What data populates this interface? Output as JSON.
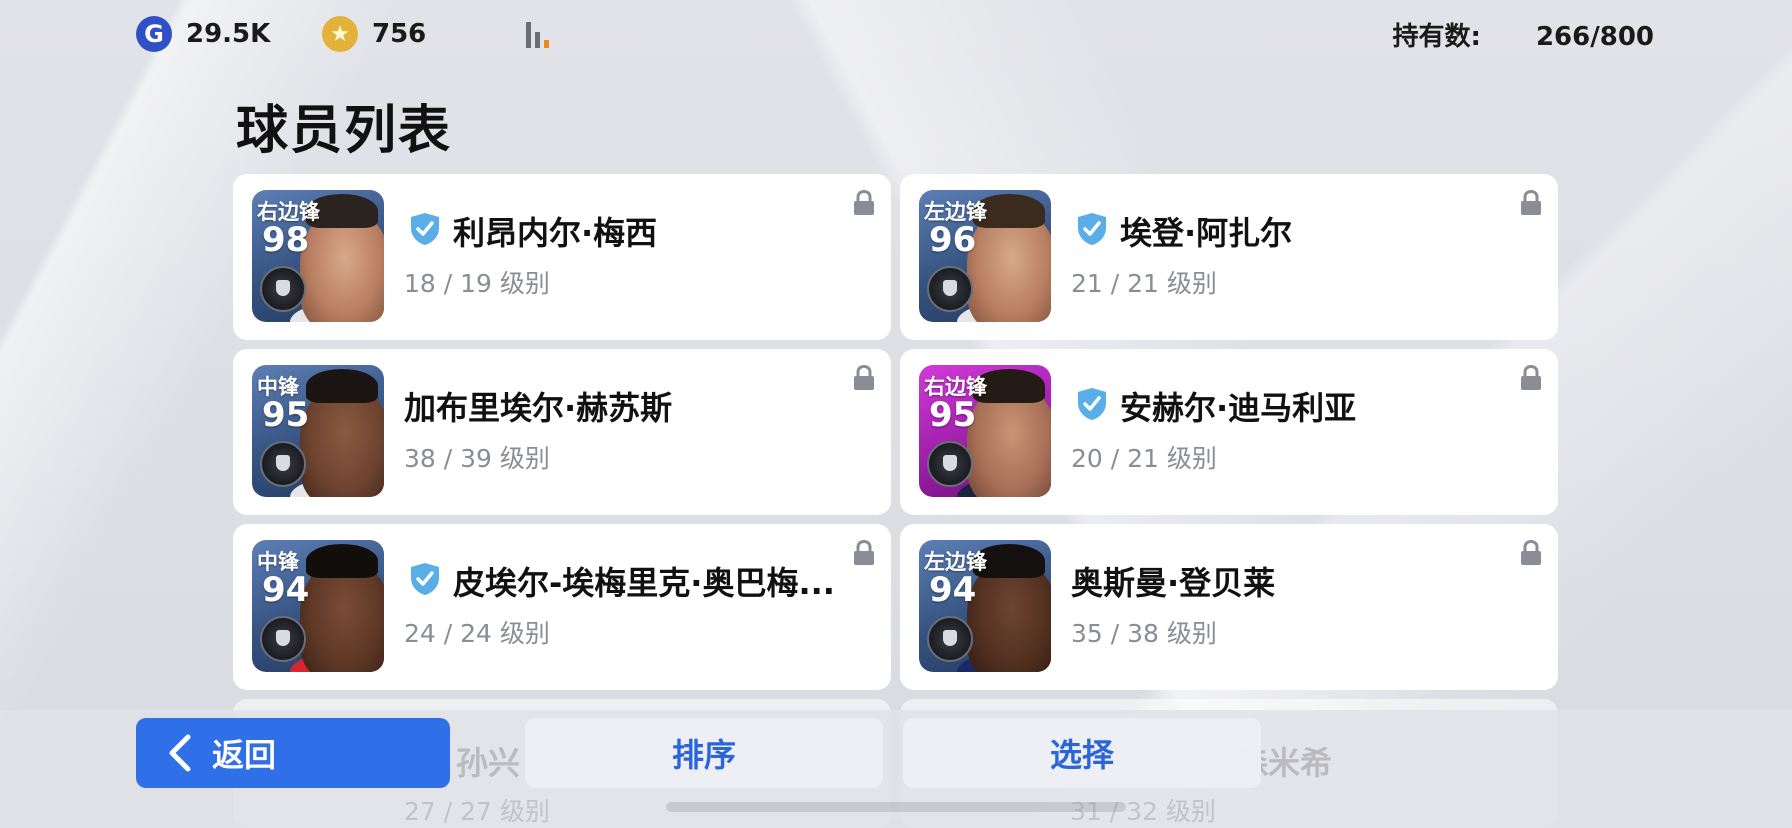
{
  "header": {
    "gp_amount": "29.5K",
    "coin_amount": "756",
    "holding_label": "持有数:",
    "holding_value": "266/800"
  },
  "page_title": "球员列表",
  "players": [
    {
      "position": "右边锋",
      "rating": "98",
      "name": "利昂内尔·梅西",
      "level": "18 / 19 级别",
      "verified": true,
      "card_color": "blue"
    },
    {
      "position": "左边锋",
      "rating": "96",
      "name": "埃登·阿扎尔",
      "level": "21 / 21 级别",
      "verified": true,
      "card_color": "blue"
    },
    {
      "position": "中锋",
      "rating": "95",
      "name": "加布里埃尔·赫苏斯",
      "level": "38 / 39 级别",
      "verified": false,
      "card_color": "blue"
    },
    {
      "position": "右边锋",
      "rating": "95",
      "name": "安赫尔·迪马利亚",
      "level": "20 / 21 级别",
      "verified": true,
      "card_color": "pink"
    },
    {
      "position": "中锋",
      "rating": "94",
      "name": "皮埃尔-埃梅里克·奥巴梅...",
      "level": "24 / 24 级别",
      "verified": true,
      "card_color": "blue"
    },
    {
      "position": "左边锋",
      "rating": "94",
      "name": "奥斯曼·登贝莱",
      "level": "35 / 38 级别",
      "verified": false,
      "card_color": "blue"
    }
  ],
  "partial_row": {
    "left_name": "孙兴",
    "left_level": "27 / 27 级别",
    "right_name": "森米希",
    "right_level": "31 / 32 级别"
  },
  "buttons": {
    "back": "返回",
    "sort": "排序",
    "select": "选择"
  },
  "colors": {
    "accent": "#2f6fe8",
    "verified": "#5aaee8",
    "pink_card": "#c02ec8",
    "blue_card": "#3e5f93"
  }
}
